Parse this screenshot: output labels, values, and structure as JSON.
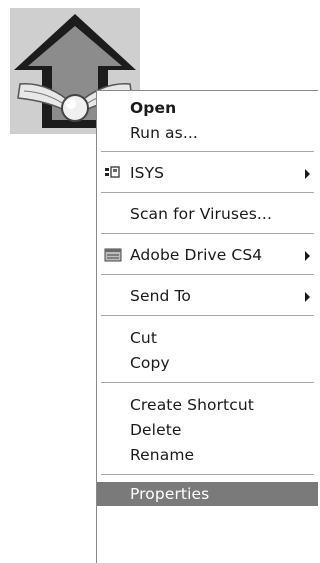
{
  "menu": {
    "open": "Open",
    "run_as": "Run as...",
    "isys": "ISYS",
    "scan": "Scan for Viruses...",
    "adobe_drive": "Adobe Drive CS4",
    "send_to": "Send To",
    "cut": "Cut",
    "copy": "Copy",
    "create_shortcut": "Create Shortcut",
    "delete": "Delete",
    "rename": "Rename",
    "properties": "Properties"
  },
  "icons": {
    "desktop": "winged-up-arrow-icon",
    "isys": "isys-app-icon",
    "adobe_drive": "adobe-drive-icon",
    "submenu": "chevron-right-icon"
  },
  "colors": {
    "selected_bg": "#7a7a7a",
    "icon_tile_bg": "#cfcfcf"
  }
}
